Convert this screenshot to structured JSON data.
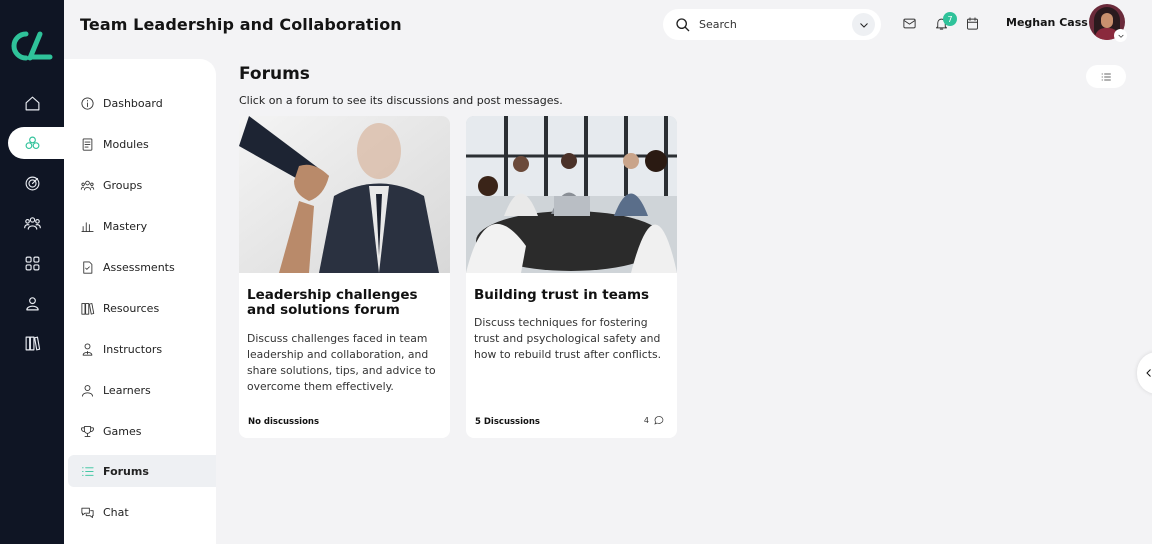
{
  "header": {
    "title": "Team Leadership and Collaboration",
    "search_placeholder": "Search",
    "notification_count": "7",
    "user_name": "Meghan Cass"
  },
  "sidebar": {
    "items": [
      {
        "label": "Dashboard",
        "icon": "info-circle-icon"
      },
      {
        "label": "Modules",
        "icon": "module-icon"
      },
      {
        "label": "Groups",
        "icon": "groups-icon"
      },
      {
        "label": "Mastery",
        "icon": "bar-chart-icon"
      },
      {
        "label": "Assessments",
        "icon": "assessment-icon"
      },
      {
        "label": "Resources",
        "icon": "books-icon"
      },
      {
        "label": "Instructors",
        "icon": "instructor-icon"
      },
      {
        "label": "Learners",
        "icon": "learners-icon"
      },
      {
        "label": "Games",
        "icon": "trophy-icon"
      },
      {
        "label": "Forums",
        "icon": "list-icon",
        "active": true
      },
      {
        "label": "Chat",
        "icon": "chat-icon"
      }
    ]
  },
  "main": {
    "title": "Forums",
    "subtitle": "Click on a forum to see its discussions and post messages.",
    "forums": [
      {
        "title": "Leadership challenges and solutions forum",
        "description": "Discuss challenges faced in team leadership and collaboration, and share solutions, tips, and advice to overcome them effectively.",
        "count_label": "No discussions",
        "replies": ""
      },
      {
        "title": "Building trust in teams",
        "description": "Discuss techniques for fostering trust and psychological safety and how to rebuild trust after conflicts.",
        "count_label": "5 Discussions",
        "replies": "4"
      }
    ]
  },
  "colors": {
    "accent": "#2fc29a",
    "rail": "#0f1524",
    "background": "#f3f3f5"
  }
}
